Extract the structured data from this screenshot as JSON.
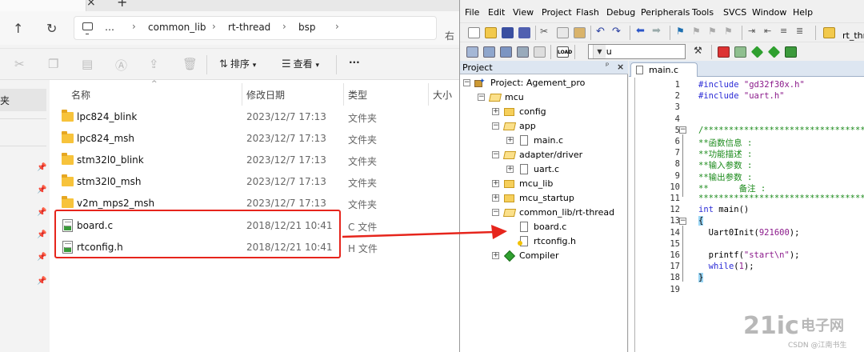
{
  "explorer": {
    "breadcrumb": [
      "…",
      "common_lib",
      "rt-thread",
      "bsp"
    ],
    "search_cut_glyph": "右",
    "toolbar": {
      "sort_label": "排序",
      "view_label": "查看",
      "more_label": "···"
    },
    "nav_selected_label": "夹",
    "columns": {
      "name": "名称",
      "date": "修改日期",
      "type": "类型",
      "size": "大小"
    },
    "rows": [
      {
        "name": "lpc824_blink",
        "date": "2023/12/7 17:13",
        "type": "文件夹",
        "kind": "folder"
      },
      {
        "name": "lpc824_msh",
        "date": "2023/12/7 17:13",
        "type": "文件夹",
        "kind": "folder"
      },
      {
        "name": "stm32l0_blink",
        "date": "2023/12/7 17:13",
        "type": "文件夹",
        "kind": "folder"
      },
      {
        "name": "stm32l0_msh",
        "date": "2023/12/7 17:13",
        "type": "文件夹",
        "kind": "folder"
      },
      {
        "name": "v2m_mps2_msh",
        "date": "2023/12/7 17:13",
        "type": "文件夹",
        "kind": "folder"
      },
      {
        "name": "board.c",
        "date": "2018/12/21 10:41",
        "type": "C 文件",
        "kind": "c-file"
      },
      {
        "name": "rtconfig.h",
        "date": "2018/12/21 10:41",
        "type": "H 文件",
        "kind": "h-file"
      }
    ],
    "highlight_color": "#e6251c"
  },
  "keil": {
    "menu": [
      "File",
      "Edit",
      "View",
      "Project",
      "Flash",
      "Debug",
      "Peripherals",
      "Tools",
      "SVCS",
      "Window",
      "Help"
    ],
    "target": "mcu",
    "toolbar_right_label": "rt_thre",
    "project_panel": {
      "title": "Project",
      "pin_glyph": "ᵖ",
      "close_glyph": "×",
      "tree": [
        {
          "label": "Project: Agement_pro",
          "kind": "root"
        },
        {
          "label": "mcu",
          "kind": "folder-open"
        },
        {
          "label": "config",
          "kind": "folder"
        },
        {
          "label": "app",
          "kind": "folder-open"
        },
        {
          "label": "main.c",
          "kind": "file"
        },
        {
          "label": "adapter/driver",
          "kind": "folder-open"
        },
        {
          "label": "uart.c",
          "kind": "file"
        },
        {
          "label": "mcu_lib",
          "kind": "folder"
        },
        {
          "label": "mcu_startup",
          "kind": "folder"
        },
        {
          "label": "common_lib/rt-thread",
          "kind": "folder-open"
        },
        {
          "label": "board.c",
          "kind": "file"
        },
        {
          "label": "rtconfig.h",
          "kind": "file-h"
        },
        {
          "label": "Compiler",
          "kind": "diamond"
        }
      ]
    },
    "editor": {
      "tab": "main.c",
      "lines": [
        "#include \"gd32f30x.h\"",
        "#include \"uart.h\"",
        "",
        "",
        "/*******************************************",
        "**函数信息 :",
        "**功能描述 :",
        "**输入参数 :",
        "**输出参数 :",
        "**      备注 :",
        "********************************************/",
        "int main()",
        "{",
        "  Uart0Init(921600);",
        "",
        "  printf(\"start\\n\");",
        "  while(1);",
        "}",
        ""
      ]
    }
  },
  "watermark": {
    "brand": "21ic",
    "cn": "电子网",
    "sub": "CSDN @江南书生"
  }
}
